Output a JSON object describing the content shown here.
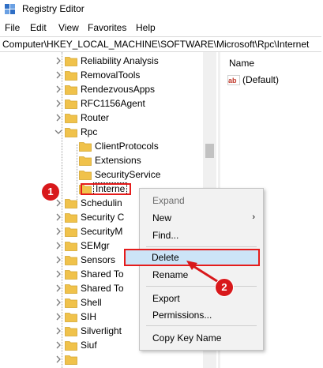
{
  "window": {
    "title": "Registry Editor"
  },
  "menu": [
    "File",
    "Edit",
    "View",
    "Favorites",
    "Help"
  ],
  "address": "Computer\\HKEY_LOCAL_MACHINE\\SOFTWARE\\Microsoft\\Rpc\\Internet",
  "tree": [
    {
      "label": "Reliability Analysis",
      "level": 0,
      "chevron": "right"
    },
    {
      "label": "RemovalTools",
      "level": 0,
      "chevron": "right"
    },
    {
      "label": "RendezvousApps",
      "level": 0,
      "chevron": "right"
    },
    {
      "label": "RFC1156Agent",
      "level": 0,
      "chevron": "right"
    },
    {
      "label": "Router",
      "level": 0,
      "chevron": "right"
    },
    {
      "label": "Rpc",
      "level": 0,
      "chevron": "down"
    },
    {
      "label": "ClientProtocols",
      "level": 1,
      "chevron": "none"
    },
    {
      "label": "Extensions",
      "level": 1,
      "chevron": "none"
    },
    {
      "label": "SecurityService",
      "level": 1,
      "chevron": "none"
    },
    {
      "label": "Interne",
      "level": 1,
      "chevron": "none",
      "selected": true
    },
    {
      "label": "Schedulin",
      "level": 0,
      "chevron": "right"
    },
    {
      "label": "Security C",
      "level": 0,
      "chevron": "right"
    },
    {
      "label": "SecurityM",
      "level": 0,
      "chevron": "right"
    },
    {
      "label": "SEMgr",
      "level": 0,
      "chevron": "right"
    },
    {
      "label": "Sensors",
      "level": 0,
      "chevron": "right"
    },
    {
      "label": "Shared To",
      "level": 0,
      "chevron": "right"
    },
    {
      "label": "Shared To",
      "level": 0,
      "chevron": "right"
    },
    {
      "label": "Shell",
      "level": 0,
      "chevron": "right"
    },
    {
      "label": "SIH",
      "level": 0,
      "chevron": "right"
    },
    {
      "label": "Silverlight",
      "level": 0,
      "chevron": "right"
    },
    {
      "label": "Siuf",
      "level": 0,
      "chevron": "right"
    },
    {
      "label": "",
      "level": 0,
      "chevron": "right"
    }
  ],
  "right_pane": {
    "column_header": "Name",
    "values": [
      "(Default)"
    ]
  },
  "context_menu": {
    "header": "Expand",
    "items": {
      "new": "New",
      "find": "Find...",
      "delete": "Delete",
      "rename": "Rename",
      "export": "Export",
      "permissions": "Permissions...",
      "copy_key_name": "Copy Key Name"
    }
  },
  "annotations": {
    "step1": "1",
    "step2": "2"
  },
  "colors": {
    "folder": "#f0c24b",
    "highlight": "#cce4f7",
    "annotation_red": "#e51c1c"
  },
  "icons": {
    "app": "registry-editor-icon",
    "folder": "folder-icon",
    "value": "string-value-icon"
  }
}
